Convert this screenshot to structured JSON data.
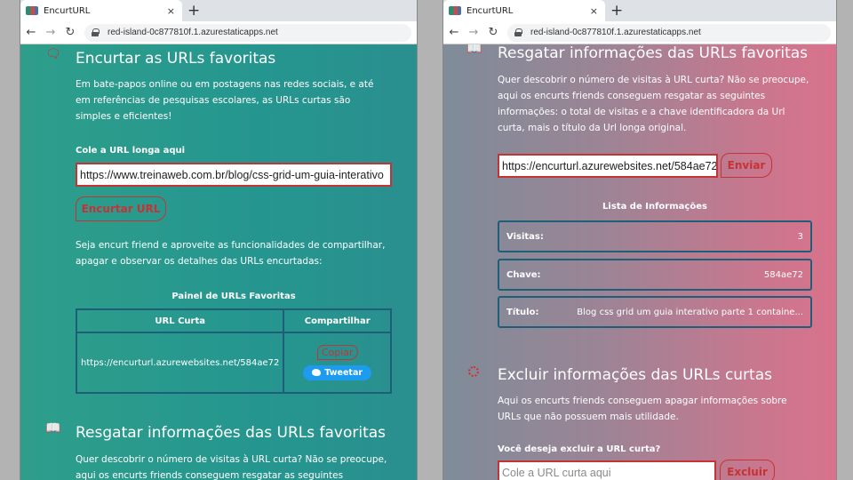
{
  "browser": {
    "tab_title": "EncurtURL",
    "tab_close": "×",
    "new_tab": "+",
    "url": "red-island-0c877810f.1.azurestaticapps.net"
  },
  "left": {
    "shorten": {
      "icon": "chat-bubble-icon",
      "title": "Encurtar as URLs favoritas",
      "text": "Em bate-papos online ou em postagens nas redes sociais, e até em referências de pesquisas escolares, as URLs curtas são simples e eficientes!",
      "input_label": "Cole a URL longa aqui",
      "input_value": "https://www.treinaweb.com.br/blog/css-grid-um-guia-interativo",
      "button": "Encurtar URL"
    },
    "share_text": "Seja encurt friend e aproveite as funcionalidades de compartilhar, apagar e observar os detalhes das URLs encurtadas:",
    "panel": {
      "title": "Painel de URLs Favoritas",
      "columns": [
        "URL Curta",
        "Compartilhar"
      ],
      "rows": [
        {
          "url": "https://encurturl.azurewebsites.net/584ae72",
          "copy": "Copiar",
          "tweet": "Tweetar"
        }
      ]
    },
    "retrieve": {
      "icon": "book-icon",
      "title": "Resgatar informações das URLs favoritas",
      "text": "Quer descobrir o número de visitas à URL curta? Não se preocupe, aqui os encurts friends conseguem resgatar as seguintes informações: o"
    }
  },
  "right": {
    "retrieve": {
      "icon": "book-icon",
      "title": "Resgatar informações das URLs favoritas",
      "text": "Quer descobrir o número de visitas à URL curta? Não se preocupe, aqui os encurts friends conseguem resgatar as seguintes informações: o total de visitas e a chave identificadora da Url curta, mais o título da Url longa original.",
      "input_value": "https://encurturl.azurewebsites.net/584ae72",
      "button": "Enviar"
    },
    "info": {
      "title": "Lista de Informações",
      "rows": [
        {
          "key": "Visitas:",
          "value": "3"
        },
        {
          "key": "Chave:",
          "value": "584ae72"
        },
        {
          "key": "Título:",
          "value": "Blog css grid um guia interativo parte 1 containe..."
        }
      ]
    },
    "delete": {
      "icon": "delete-icon",
      "title": "Excluir informações das URLs curtas",
      "text": "Aqui os encurts friends conseguem apagar informações sobre URLs que não possuem mais utilidade.",
      "input_label": "Você deseja excluir a URL curta?",
      "input_placeholder": "Cole a URL curta aqui",
      "button": "Excluir"
    }
  }
}
